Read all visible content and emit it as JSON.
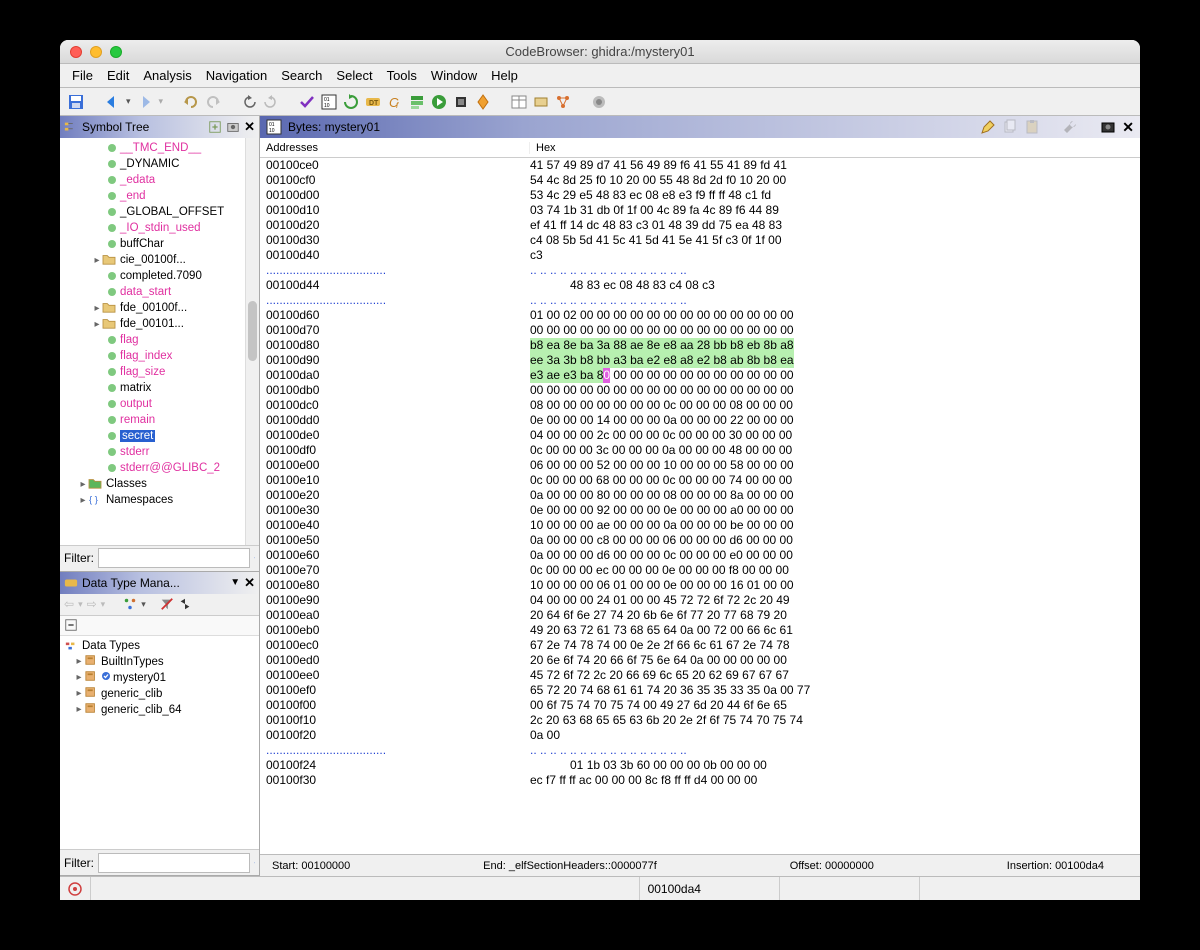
{
  "window_title": "CodeBrowser: ghidra:/mystery01",
  "menus": [
    "File",
    "Edit",
    "Analysis",
    "Navigation",
    "Search",
    "Select",
    "Tools",
    "Window",
    "Help"
  ],
  "symbol_tree": {
    "title": "Symbol Tree",
    "filter_label": "Filter:",
    "items": [
      {
        "indent": 3,
        "dot": true,
        "label": "__TMC_END__",
        "pink": true
      },
      {
        "indent": 3,
        "dot": true,
        "label": "_DYNAMIC"
      },
      {
        "indent": 3,
        "dot": true,
        "label": "_edata",
        "pink": true
      },
      {
        "indent": 3,
        "dot": true,
        "label": "_end",
        "pink": true
      },
      {
        "indent": 3,
        "dot": true,
        "label": "_GLOBAL_OFFSET"
      },
      {
        "indent": 3,
        "dot": true,
        "label": "_IO_stdin_used",
        "pink": true
      },
      {
        "indent": 3,
        "dot": true,
        "label": "buffChar"
      },
      {
        "indent": 2,
        "tw": "▸",
        "folder": true,
        "label": "cie_00100f..."
      },
      {
        "indent": 3,
        "dot": true,
        "label": "completed.7090"
      },
      {
        "indent": 3,
        "dot": true,
        "label": "data_start",
        "pink": true
      },
      {
        "indent": 2,
        "tw": "▸",
        "folder": true,
        "label": "fde_00100f..."
      },
      {
        "indent": 2,
        "tw": "▸",
        "folder": true,
        "label": "fde_00101..."
      },
      {
        "indent": 3,
        "dot": true,
        "label": "flag",
        "pink": true
      },
      {
        "indent": 3,
        "dot": true,
        "label": "flag_index",
        "pink": true
      },
      {
        "indent": 3,
        "dot": true,
        "label": "flag_size",
        "pink": true
      },
      {
        "indent": 3,
        "dot": true,
        "label": "matrix"
      },
      {
        "indent": 3,
        "dot": true,
        "label": "output",
        "pink": true
      },
      {
        "indent": 3,
        "dot": true,
        "label": "remain",
        "pink": true
      },
      {
        "indent": 3,
        "dot": true,
        "label": "secret",
        "pink": true,
        "selected": true
      },
      {
        "indent": 3,
        "dot": true,
        "label": "stderr",
        "pink": true
      },
      {
        "indent": 3,
        "dot": true,
        "label": "stderr@@GLIBC_2",
        "pink": true
      },
      {
        "indent": 1,
        "tw": "▸",
        "folder": true,
        "label": "Classes",
        "folder_color": "#5bb65b"
      },
      {
        "indent": 1,
        "tw": "▸",
        "ns": true,
        "label": "Namespaces"
      }
    ]
  },
  "dtm": {
    "title": "Data Type Mana...",
    "root": "Data Types",
    "items": [
      {
        "label": "BuiltInTypes"
      },
      {
        "label": "mystery01",
        "check": true
      },
      {
        "label": "generic_clib"
      },
      {
        "label": "generic_clib_64"
      }
    ],
    "filter_label": "Filter:"
  },
  "bytes": {
    "title": "Bytes: mystery01",
    "col_addr": "Addresses",
    "col_hex": "Hex",
    "rows": [
      {
        "addr": "00100ce0",
        "hex": "41 57 49 89 d7 41 56 49 89 f6 41 55 41 89 fd 41"
      },
      {
        "addr": "00100cf0",
        "hex": "54 4c 8d 25 f0 10 20 00 55 48 8d 2d f0 10 20 00"
      },
      {
        "addr": "00100d00",
        "hex": "53 4c 29 e5 48 83 ec 08 e8 e3 f9 ff ff 48 c1 fd"
      },
      {
        "addr": "00100d10",
        "hex": "03 74 1b 31 db 0f 1f 00 4c 89 fa 4c 89 f6 44 89"
      },
      {
        "addr": "00100d20",
        "hex": "ef 41 ff 14 dc 48 83 c3 01 48 39 dd 75 ea 48 83"
      },
      {
        "addr": "00100d30",
        "hex": "c4 08 5b 5d 41 5c 41 5d 41 5e 41 5f c3 0f 1f 00"
      },
      {
        "addr": "00100d40",
        "hex": "c3"
      },
      {
        "dots": true
      },
      {
        "addr": "00100d44",
        "hex": "            48 83 ec 08 48 83 c4 08 c3"
      },
      {
        "dots": true
      },
      {
        "addr": "00100d60",
        "hex": "01 00 02 00 00 00 00 00 00 00 00 00 00 00 00 00"
      },
      {
        "addr": "00100d70",
        "hex": "00 00 00 00 00 00 00 00 00 00 00 00 00 00 00 00"
      },
      {
        "addr": "00100d80",
        "hex": "b8 ea 8e ba 3a 88 ae 8e e8 aa 28 bb b8 eb 8b a8",
        "hl": true
      },
      {
        "addr": "00100d90",
        "hex": "ee 3a 3b b8 bb a3 ba e2 e8 a8 e2 b8 ab 8b b8 ea",
        "hl": true
      },
      {
        "addr": "00100da0",
        "hex": "e3 ae e3 ba 8",
        "cursor": "0",
        "hex2": " 00 00 00 00 00 00 00 00 00 00 00",
        "hl": true,
        "hl_partial": true
      },
      {
        "addr": "00100db0",
        "hex": "00 00 00 00 00 00 00 00 00 00 00 00 00 00 00 00"
      },
      {
        "addr": "00100dc0",
        "hex": "08 00 00 00 00 00 00 00 0c 00 00 00 08 00 00 00"
      },
      {
        "addr": "00100dd0",
        "hex": "0e 00 00 00 14 00 00 00 0a 00 00 00 22 00 00 00"
      },
      {
        "addr": "00100de0",
        "hex": "04 00 00 00 2c 00 00 00 0c 00 00 00 30 00 00 00"
      },
      {
        "addr": "00100df0",
        "hex": "0c 00 00 00 3c 00 00 00 0a 00 00 00 48 00 00 00"
      },
      {
        "addr": "00100e00",
        "hex": "06 00 00 00 52 00 00 00 10 00 00 00 58 00 00 00"
      },
      {
        "addr": "00100e10",
        "hex": "0c 00 00 00 68 00 00 00 0c 00 00 00 74 00 00 00"
      },
      {
        "addr": "00100e20",
        "hex": "0a 00 00 00 80 00 00 00 08 00 00 00 8a 00 00 00"
      },
      {
        "addr": "00100e30",
        "hex": "0e 00 00 00 92 00 00 00 0e 00 00 00 a0 00 00 00"
      },
      {
        "addr": "00100e40",
        "hex": "10 00 00 00 ae 00 00 00 0a 00 00 00 be 00 00 00"
      },
      {
        "addr": "00100e50",
        "hex": "0a 00 00 00 c8 00 00 00 06 00 00 00 d6 00 00 00"
      },
      {
        "addr": "00100e60",
        "hex": "0a 00 00 00 d6 00 00 00 0c 00 00 00 e0 00 00 00"
      },
      {
        "addr": "00100e70",
        "hex": "0c 00 00 00 ec 00 00 00 0e 00 00 00 f8 00 00 00"
      },
      {
        "addr": "00100e80",
        "hex": "10 00 00 00 06 01 00 00 0e 00 00 00 16 01 00 00"
      },
      {
        "addr": "00100e90",
        "hex": "04 00 00 00 24 01 00 00 45 72 72 6f 72 2c 20 49"
      },
      {
        "addr": "00100ea0",
        "hex": "20 64 6f 6e 27 74 20 6b 6e 6f 77 20 77 68 79 20"
      },
      {
        "addr": "00100eb0",
        "hex": "49 20 63 72 61 73 68 65 64 0a 00 72 00 66 6c 61"
      },
      {
        "addr": "00100ec0",
        "hex": "67 2e 74 78 74 00 0e 2e 2f 66 6c 61 67 2e 74 78"
      },
      {
        "addr": "00100ed0",
        "hex": "20 6e 6f 74 20 66 6f 75 6e 64 0a 00 00 00 00 00"
      },
      {
        "addr": "00100ee0",
        "hex": "45 72 6f 72 2c 20 66 69 6c 65 20 62 69 67 67 67"
      },
      {
        "addr": "00100ef0",
        "hex": "65 72 20 74 68 61 61 74 20 36 35 35 33 35 0a 00 77"
      },
      {
        "addr": "00100f00",
        "hex": "00 6f 75 74 70 75 74 00 49 27 6d 20 44 6f 6e 65"
      },
      {
        "addr": "00100f10",
        "hex": "2c 20 63 68 65 65 63 6b 20 2e 2f 6f 75 74 70 75 74"
      },
      {
        "addr": "00100f20",
        "hex": "0a 00"
      },
      {
        "dots": true
      },
      {
        "addr": "00100f24",
        "hex": "            01 1b 03 3b 60 00 00 00 0b 00 00 00"
      },
      {
        "addr": "00100f30",
        "hex": "ec f7 ff ff ac 00 00 00 8c f8 ff ff d4 00 00 00"
      }
    ]
  },
  "status": {
    "start": "Start: 00100000",
    "end": "End: _elfSectionHeaders::0000077f",
    "offset": "Offset: 00000000",
    "insertion": "Insertion: 00100da4"
  },
  "footer_address": "00100da4"
}
